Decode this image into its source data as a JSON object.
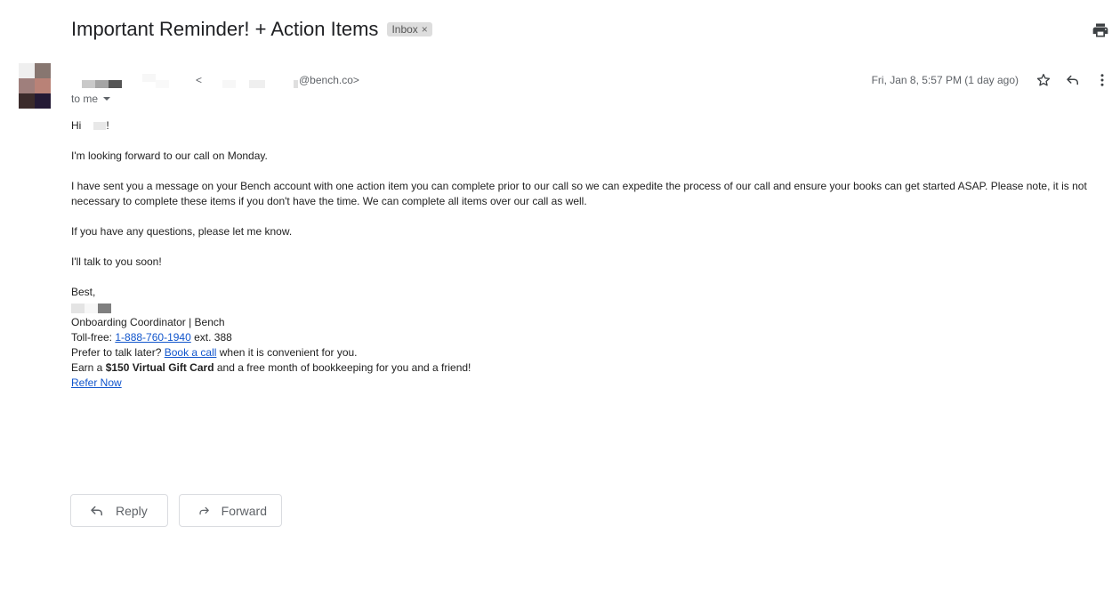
{
  "email": {
    "subject": "Important Reminder! + Action Items",
    "label_chip": "Inbox",
    "label_chip_remove": "×",
    "sender_email_domain": "@bench.co>",
    "sender_email_open": "<",
    "recipient": "to me",
    "date": "Fri, Jan 8, 5:57 PM (1 day ago)"
  },
  "icons": {
    "print": "printer-icon",
    "star": "star-icon",
    "reply": "reply-icon",
    "more": "more-vert-icon",
    "forward": "forward-icon"
  },
  "avatar_colors": [
    "#efefef",
    "#877670",
    "#9f7f7c",
    "#b98277",
    "#3b2b2b",
    "#241a35"
  ],
  "body": {
    "greeting_prefix": "Hi",
    "greeting_suffix": "!",
    "para1": "I'm looking forward to our call on Monday.",
    "para2": "I have sent you a message on your Bench account with one action item you can complete prior to our call so we can expedite the process of our call and ensure your books can get started ASAP. Please note, it is not necessary to complete these items if you don't have the time. We can complete all items over our call as well.",
    "para3": "If you have any questions, please let me know.",
    "para4": "I'll talk to you soon!",
    "signoff": "Best,",
    "signature": {
      "title": "Onboarding Coordinator | Bench",
      "tollfree_label": "Toll-free: ",
      "phone": "1-888-760-1940",
      "ext": " ext. 388",
      "prefer_text": "Prefer to talk later? ",
      "book_call": "Book a call",
      "prefer_suffix": " when it is convenient for you.",
      "earn_prefix": "Earn a ",
      "earn_bold": "$150 Virtual Gift Card",
      "earn_suffix": " and a free month of bookkeeping for you and a friend!",
      "refer": "Refer Now"
    }
  },
  "actions": {
    "reply": "Reply",
    "forward": "Forward"
  },
  "colors": {
    "link": "#1155cc",
    "muted": "#5f6368"
  }
}
